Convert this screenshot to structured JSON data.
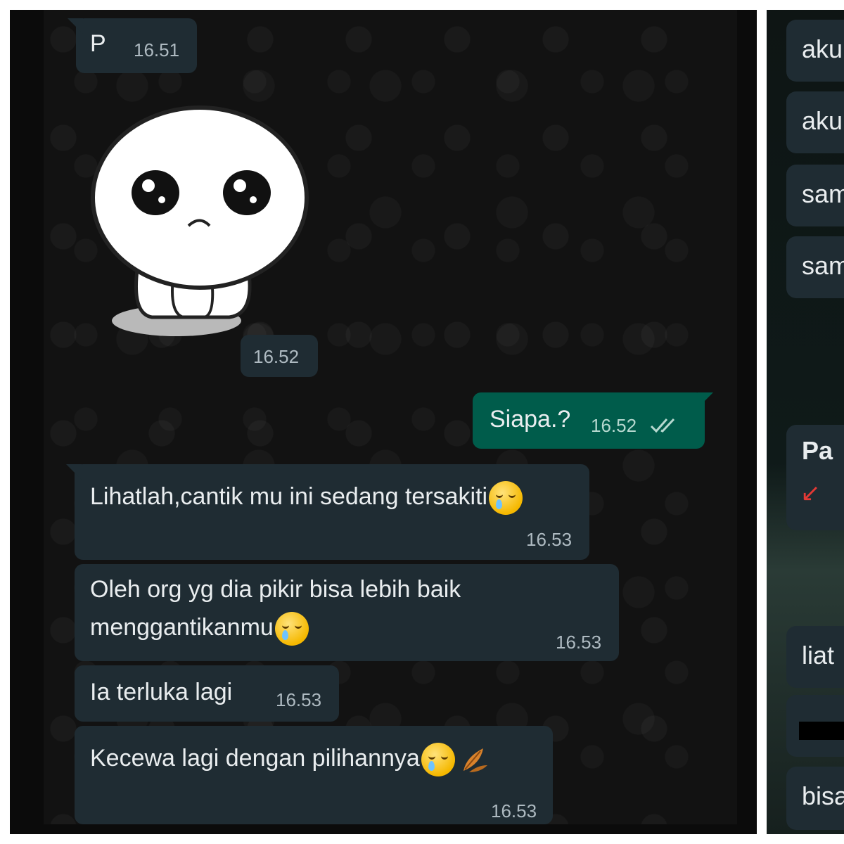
{
  "left_chat": {
    "msg1": {
      "text": "P",
      "time": "16.51"
    },
    "sticker": {
      "name": "sad-blob-sticker",
      "time": "16.52"
    },
    "msg_out": {
      "text": "Siapa.?",
      "time": "16.52"
    },
    "msg2": {
      "text": "Lihatlah,cantik mu ini sedang tersakiti",
      "time": "16.53"
    },
    "msg3": {
      "line1": "Oleh org yg dia pikir bisa lebih baik",
      "line2": "menggantikanmu",
      "time": "16.53"
    },
    "msg4": {
      "text": "Ia terluka lagi",
      "time": "16.53"
    },
    "msg5": {
      "text": "Kecewa lagi dengan pilihannya",
      "time": "16.53"
    }
  },
  "right_chat": {
    "items": [
      "aku",
      "aku",
      "sam",
      "sam",
      "Pa",
      "liat",
      "bisa"
    ]
  },
  "icons": {
    "emoji": "crying-face-emoji",
    "leaf": "fallen-leaf-emoji",
    "ticks": "double-check-icon",
    "arrow": "red-arrow-icon"
  },
  "colors": {
    "incoming_bubble": "#1f2c33",
    "outgoing_bubble": "#005c4b",
    "chat_background": "#121212",
    "text": "#e9edef"
  }
}
